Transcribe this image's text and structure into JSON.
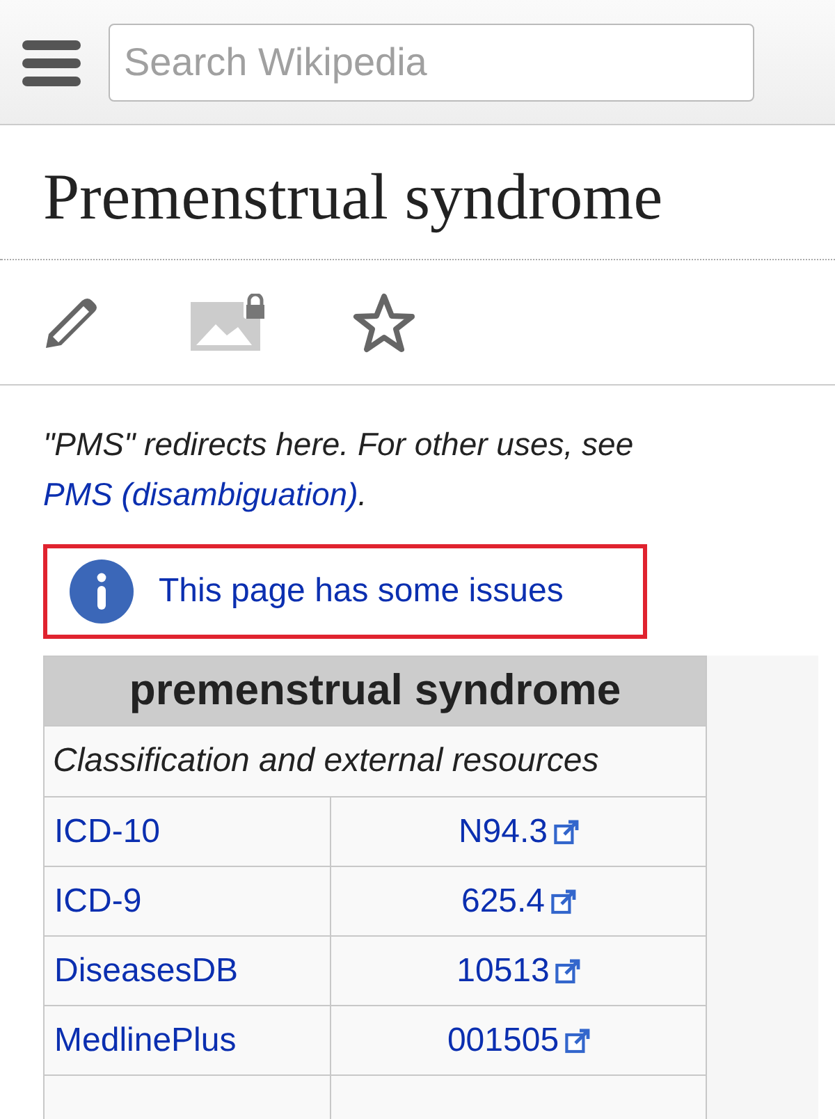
{
  "search": {
    "placeholder": "Search Wikipedia"
  },
  "title": "Premenstrual syndrome",
  "hatnote": {
    "text": "\"PMS\" redirects here. For other uses, see ",
    "link": "PMS (disambiguation)",
    "end": "."
  },
  "issues": {
    "text": "This page has some issues"
  },
  "infobox": {
    "title": "premenstrual syndrome",
    "subtitle": "Classification and external resources",
    "rows": [
      {
        "label": "ICD-10",
        "value": "N94.3"
      },
      {
        "label": "ICD-9",
        "value": "625.4"
      },
      {
        "label": "DiseasesDB",
        "value": "10513"
      },
      {
        "label": "MedlinePlus",
        "value": "001505"
      }
    ]
  }
}
